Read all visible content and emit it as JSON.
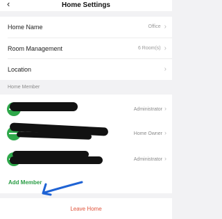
{
  "header": {
    "back_icon": "chevron-left-icon",
    "title": "Home Settings"
  },
  "settings": [
    {
      "label": "Home Name",
      "value": "Office"
    },
    {
      "label": "Room Management",
      "value": "6 Room(s)"
    },
    {
      "label": "Location",
      "value": ""
    }
  ],
  "members_section": {
    "label": "Home Member"
  },
  "members": [
    {
      "role": "Administrator"
    },
    {
      "role": "Home Owner"
    },
    {
      "role": "Administrator"
    }
  ],
  "add_member": {
    "label": "Add Member"
  },
  "leave_home": {
    "label": "Leave Home"
  },
  "colors": {
    "accent_green": "#2a9d45",
    "danger_red": "#e0533b",
    "annotation_blue": "#1f63d4"
  }
}
